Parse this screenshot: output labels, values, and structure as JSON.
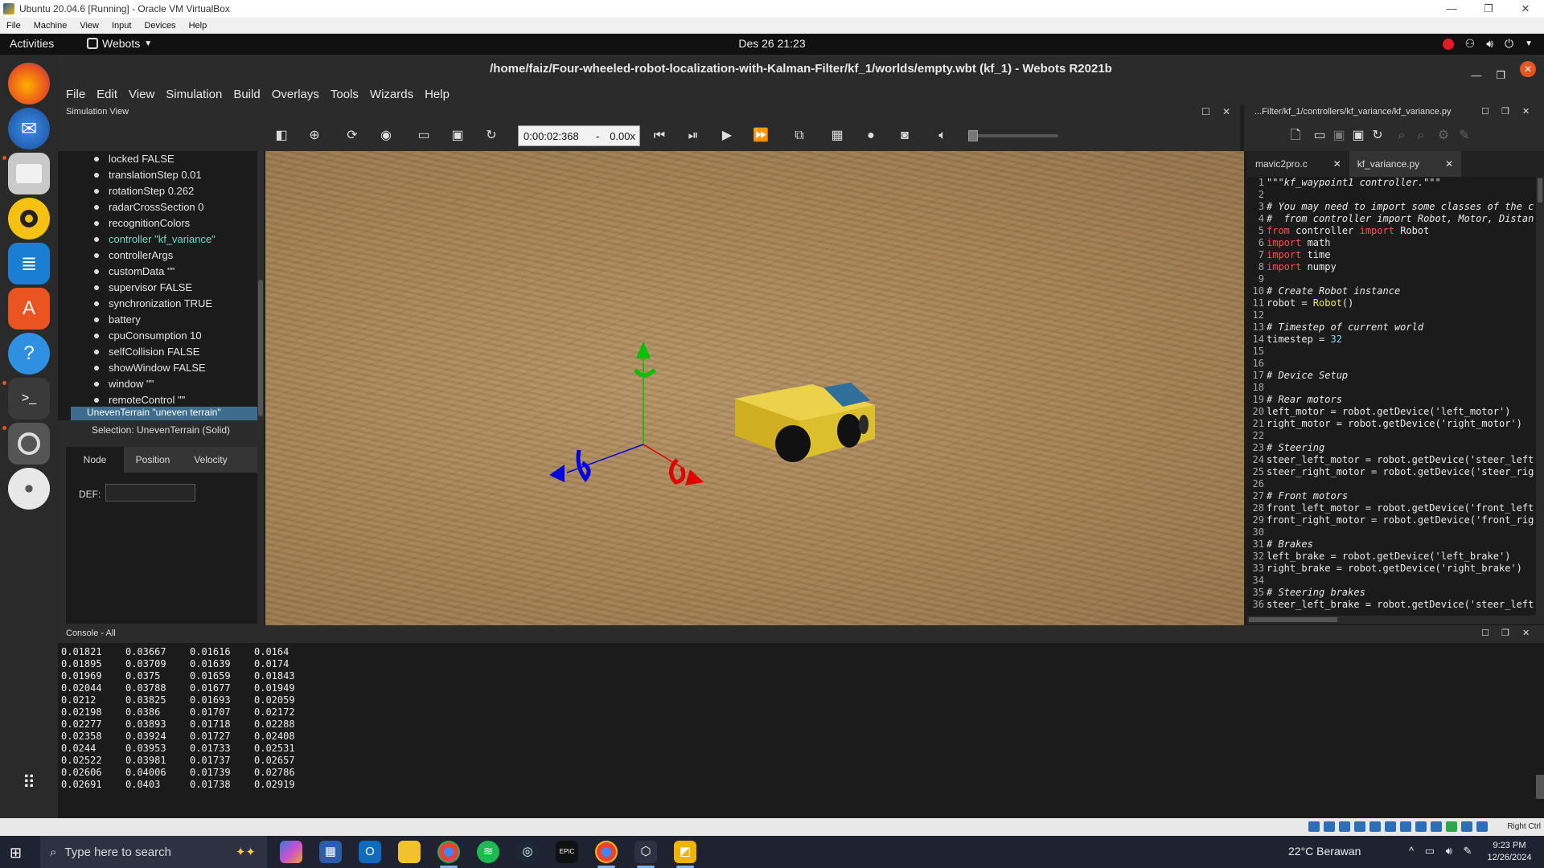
{
  "vbox": {
    "title": "Ubuntu 20.04.6 [Running] - Oracle VM VirtualBox",
    "menu": [
      "File",
      "Machine",
      "View",
      "Input",
      "Devices",
      "Help"
    ],
    "host_key": "Right Ctrl"
  },
  "gnome": {
    "activities": "Activities",
    "app_name": "Webots",
    "clock": "Des 26  21:23"
  },
  "webots": {
    "title": "/home/faiz/Four-wheeled-robot-localization-with-Kalman-Filter/kf_1/worlds/empty.wbt (kf_1) - Webots R2021b",
    "menu": [
      "File",
      "Edit",
      "View",
      "Simulation",
      "Build",
      "Overlays",
      "Tools",
      "Wizards",
      "Help"
    ],
    "sim_view_label": "Simulation View",
    "sim_time": "0:00:02:368",
    "speed_sep": "-",
    "speed": "0.00x",
    "scene_tree": [
      "locked FALSE",
      "translationStep 0.01",
      "rotationStep 0.262",
      "radarCrossSection 0",
      "recognitionColors",
      "controller \"kf_variance\"",
      "controllerArgs",
      "customData \"\"",
      "supervisor FALSE",
      "synchronization TRUE",
      "battery",
      "cpuConsumption 10",
      "selfCollision FALSE",
      "showWindow FALSE",
      "window \"\"",
      "remoteControl \"\""
    ],
    "scene_tree_cut_row": "UnevenTerrain \"uneven terrain\"",
    "selection": "Selection: UnevenTerrain (Solid)",
    "node_tabs": [
      "Node",
      "Position",
      "Velocity"
    ],
    "def_label": "DEF:",
    "def_value": ""
  },
  "editor": {
    "path": "...Filter/kf_1/controllers/kf_variance/kf_variance.py",
    "tabs": [
      {
        "label": "mavic2pro.c",
        "close": "✕"
      },
      {
        "label": "kf_variance.py",
        "close": "✕"
      }
    ],
    "lines": [
      {
        "n": "1",
        "t": "\"\"\"kf_waypoint1 controller.\"\"\"",
        "c": "comment"
      },
      {
        "n": "2",
        "t": "",
        "c": ""
      },
      {
        "n": "3",
        "t": "# You may need to import some classes of the c",
        "c": "comment"
      },
      {
        "n": "4",
        "t": "#  from controller import Robot, Motor, Distan",
        "c": "comment"
      },
      {
        "n": "5",
        "t": "from controller import Robot",
        "c": "import"
      },
      {
        "n": "6",
        "t": "import math",
        "c": "import"
      },
      {
        "n": "7",
        "t": "import time",
        "c": "import"
      },
      {
        "n": "8",
        "t": "import numpy",
        "c": "import"
      },
      {
        "n": "9",
        "t": "",
        "c": ""
      },
      {
        "n": "10",
        "t": "# Create Robot instance",
        "c": "comment"
      },
      {
        "n": "11",
        "t": "robot = Robot()",
        "c": "call"
      },
      {
        "n": "12",
        "t": "",
        "c": ""
      },
      {
        "n": "13",
        "t": "# Timestep of current world",
        "c": "comment"
      },
      {
        "n": "14",
        "t": "timestep = 32",
        "c": "num"
      },
      {
        "n": "15",
        "t": "",
        "c": ""
      },
      {
        "n": "16",
        "t": "",
        "c": ""
      },
      {
        "n": "17",
        "t": "# Device Setup",
        "c": "comment"
      },
      {
        "n": "18",
        "t": "",
        "c": ""
      },
      {
        "n": "19",
        "t": "# Rear motors",
        "c": "comment"
      },
      {
        "n": "20",
        "t": "left_motor = robot.getDevice('left_motor')",
        "c": ""
      },
      {
        "n": "21",
        "t": "right_motor = robot.getDevice('right_motor')",
        "c": ""
      },
      {
        "n": "22",
        "t": "",
        "c": ""
      },
      {
        "n": "23",
        "t": "# Steering",
        "c": "comment"
      },
      {
        "n": "24",
        "t": "steer_left_motor = robot.getDevice('steer_left",
        "c": ""
      },
      {
        "n": "25",
        "t": "steer_right_motor = robot.getDevice('steer_rig",
        "c": ""
      },
      {
        "n": "26",
        "t": "",
        "c": ""
      },
      {
        "n": "27",
        "t": "# Front motors",
        "c": "comment"
      },
      {
        "n": "28",
        "t": "front_left_motor = robot.getDevice('front_left",
        "c": ""
      },
      {
        "n": "29",
        "t": "front_right_motor = robot.getDevice('front_rig",
        "c": ""
      },
      {
        "n": "30",
        "t": "",
        "c": ""
      },
      {
        "n": "31",
        "t": "# Brakes",
        "c": "comment"
      },
      {
        "n": "32",
        "t": "left_brake = robot.getDevice('left_brake')",
        "c": ""
      },
      {
        "n": "33",
        "t": "right_brake = robot.getDevice('right_brake')",
        "c": ""
      },
      {
        "n": "34",
        "t": "",
        "c": ""
      },
      {
        "n": "35",
        "t": "# Steering brakes",
        "c": "comment"
      },
      {
        "n": "36",
        "t": "steer_left_brake = robot.getDevice('steer_left",
        "c": ""
      }
    ]
  },
  "console": {
    "title": "Console - All",
    "rows": [
      [
        "0.01821",
        "0.03667",
        "0.01616",
        "0.0164"
      ],
      [
        "0.01895",
        "0.03709",
        "0.01639",
        "0.0174"
      ],
      [
        "0.01969",
        "0.0375",
        "0.01659",
        "0.01843"
      ],
      [
        "0.02044",
        "0.03788",
        "0.01677",
        "0.01949"
      ],
      [
        "0.0212",
        "0.03825",
        "0.01693",
        "0.02059"
      ],
      [
        "0.02198",
        "0.0386",
        "0.01707",
        "0.02172"
      ],
      [
        "0.02277",
        "0.03893",
        "0.01718",
        "0.02288"
      ],
      [
        "0.02358",
        "0.03924",
        "0.01727",
        "0.02408"
      ],
      [
        "0.0244",
        "0.03953",
        "0.01733",
        "0.02531"
      ],
      [
        "0.02522",
        "0.03981",
        "0.01737",
        "0.02657"
      ],
      [
        "0.02606",
        "0.04006",
        "0.01739",
        "0.02786"
      ],
      [
        "0.02691",
        "0.0403",
        "0.01738",
        "0.02919"
      ]
    ]
  },
  "taskbar": {
    "search_placeholder": "Type here to search",
    "weather": "22°C  Berawan",
    "time": "9:23 PM",
    "date": "12/26/2024"
  },
  "colors": {
    "accent_orange": "#e95420",
    "axis_x": "#e00000",
    "axis_y": "#00c000",
    "axis_z": "#0000e0",
    "robot_body": "#e6c92a",
    "robot_panel": "#2f6f9a"
  },
  "icons": [
    "firefox-icon",
    "thunderbird-icon",
    "files-icon",
    "rhythmbox-icon",
    "writer-icon",
    "software-icon",
    "help-icon",
    "terminal-icon",
    "settings-icon",
    "dvd-icon",
    "apps-grid-icon"
  ]
}
